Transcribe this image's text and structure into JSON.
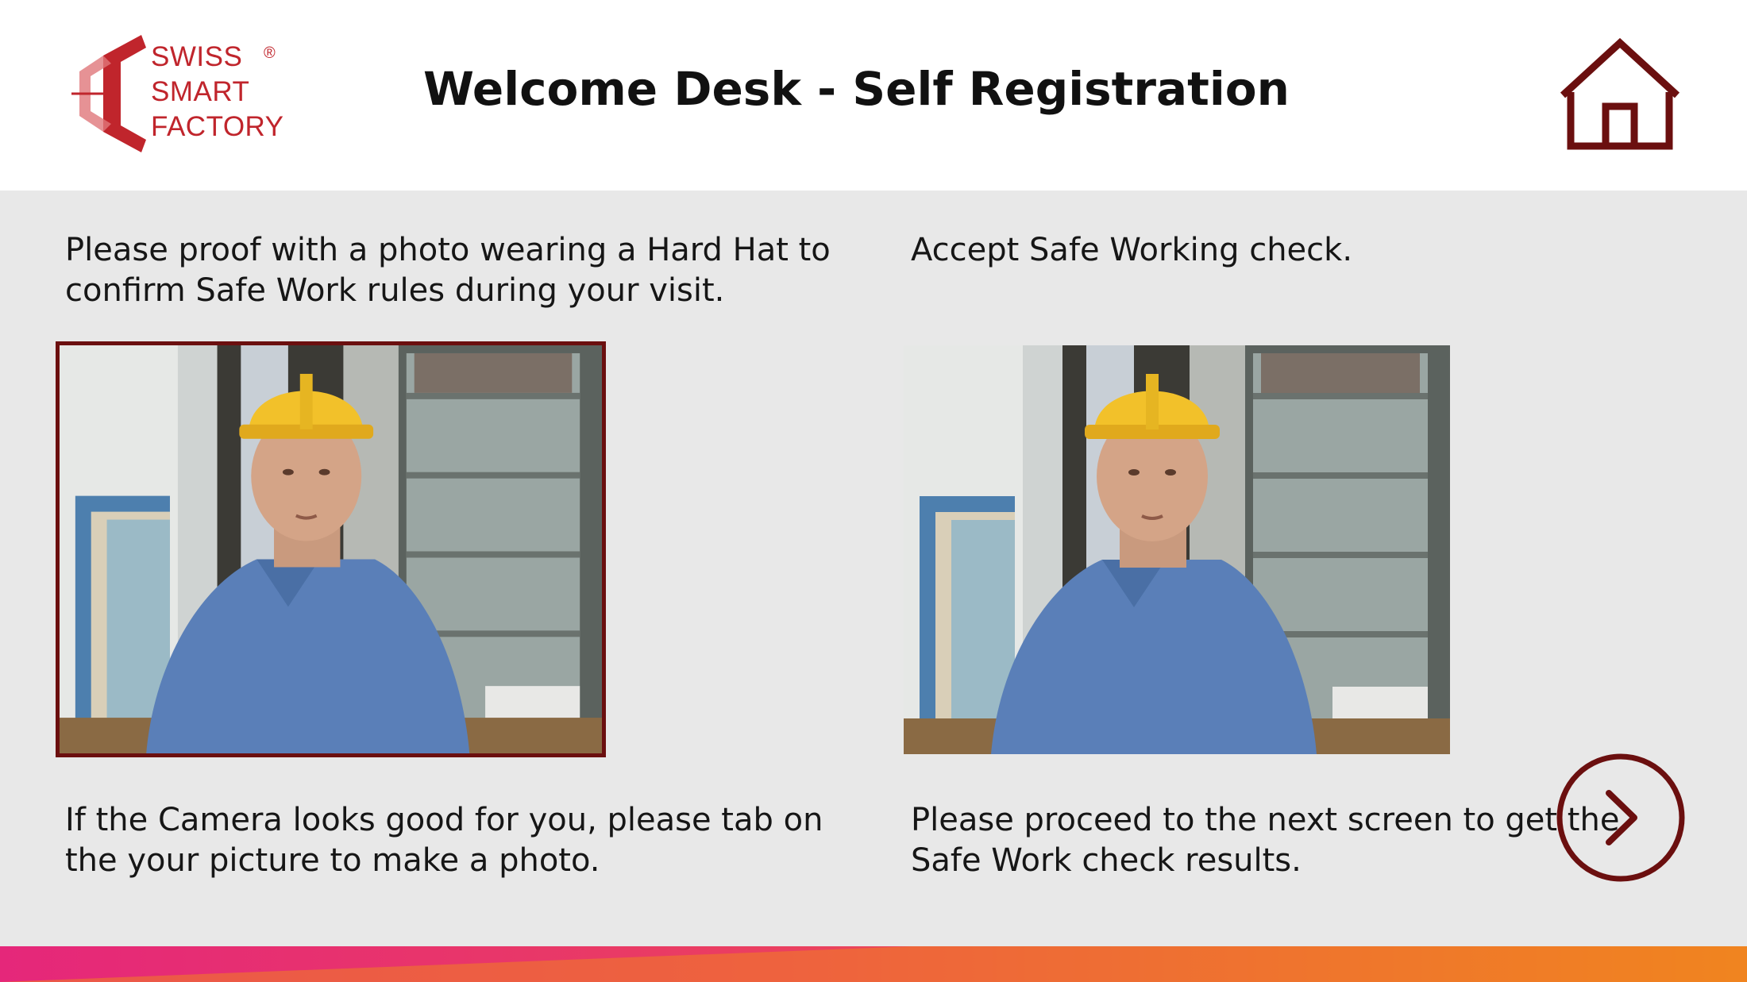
{
  "header": {
    "logo": {
      "line1": "SWISS",
      "line2": "SMART",
      "line3": "FACTORY",
      "registered_mark": "®"
    },
    "title": "Welcome Desk - Self Registration",
    "home_icon": "home-icon"
  },
  "main": {
    "left_instruction": "Please proof with a photo wearing a Hard Hat to confirm Safe Work rules during your visit.",
    "right_instruction": "Accept Safe Working check.",
    "left_caption": "If the Camera looks good for you, please tab on the your picture to make a photo.",
    "right_caption": "Please proceed to the next screen to get the Safe Work check results.",
    "camera_preview_icon": "person-hard-hat-photo",
    "captured_photo_icon": "person-hard-hat-photo",
    "next_icon": "chevron-right-circle-icon"
  },
  "colors": {
    "brand_red": "#c0252c",
    "accent_maroon": "#6b0f0f",
    "content_bg": "#e8e8e8",
    "gradient_start": "#e5277a",
    "gradient_end": "#f08a1c"
  }
}
